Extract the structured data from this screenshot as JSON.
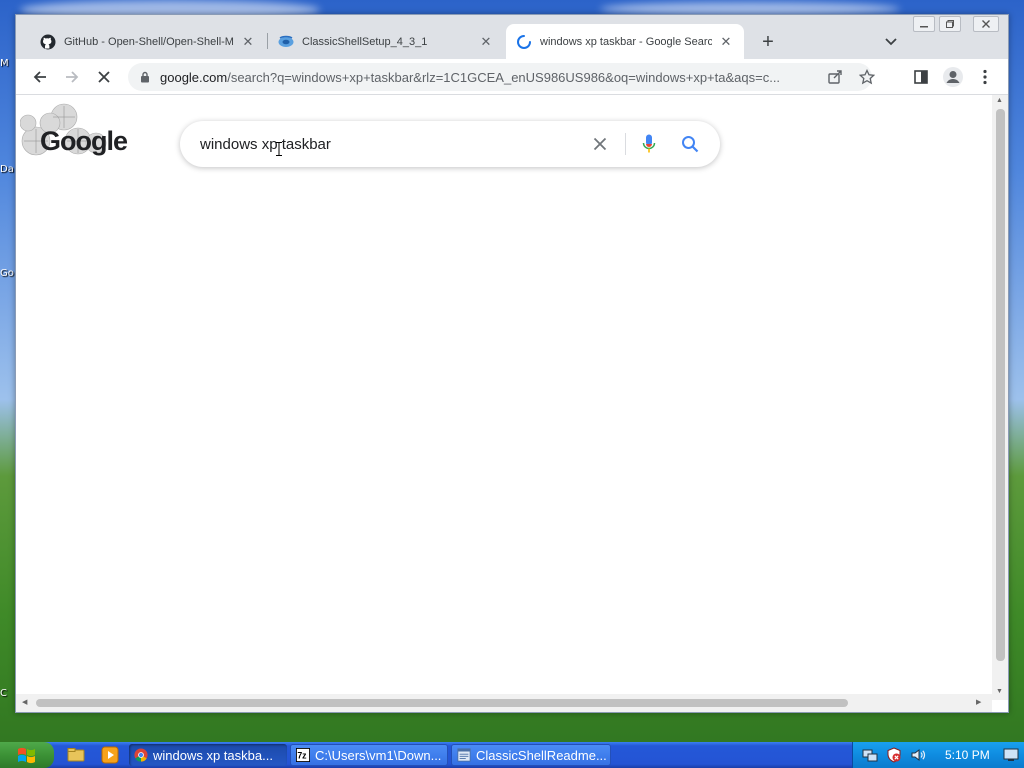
{
  "desktop": {
    "icon_labels": [
      "M",
      "Da",
      "Go",
      "C"
    ]
  },
  "browser": {
    "window_controls": {
      "minimize": "minimize-icon",
      "restore": "restore-icon",
      "close": "close-icon"
    },
    "tabs": [
      {
        "title": "GitHub - Open-Shell/Open-Shell-Me",
        "icon": "github-icon",
        "active": false
      },
      {
        "title": "ClassicShellSetup_4_3_1",
        "icon": "classic-shell-icon",
        "active": false
      },
      {
        "title": "windows xp taskbar - Google Search",
        "icon": "loading-spinner-icon",
        "active": true
      }
    ],
    "tab_close_glyph": "✕",
    "new_tab_glyph": "+",
    "address_bar": {
      "host": "google.com",
      "path": "/search?q=windows+xp+taskbar&rlz=1C1GCEA_enUS986US986&oq=windows+xp+ta&aqs=c..."
    }
  },
  "search": {
    "query": "windows xp taskbar",
    "logo_text": "Google"
  },
  "taskbar": {
    "items": [
      {
        "label": "windows xp taskba...",
        "icon": "chrome-icon",
        "active": true
      },
      {
        "label": "C:\\Users\\vm1\\Down...",
        "icon": "7zip-icon",
        "active": false
      },
      {
        "label": "ClassicShellReadme...",
        "icon": "document-icon",
        "active": false
      }
    ],
    "clock": "5:10 PM"
  },
  "colors": {
    "google_blue": "#4285f4",
    "google_red": "#ea4335",
    "google_yellow": "#fbbc05",
    "google_green": "#34a853",
    "taskbar_blue": "#2454d4",
    "start_green": "#3c9236"
  }
}
